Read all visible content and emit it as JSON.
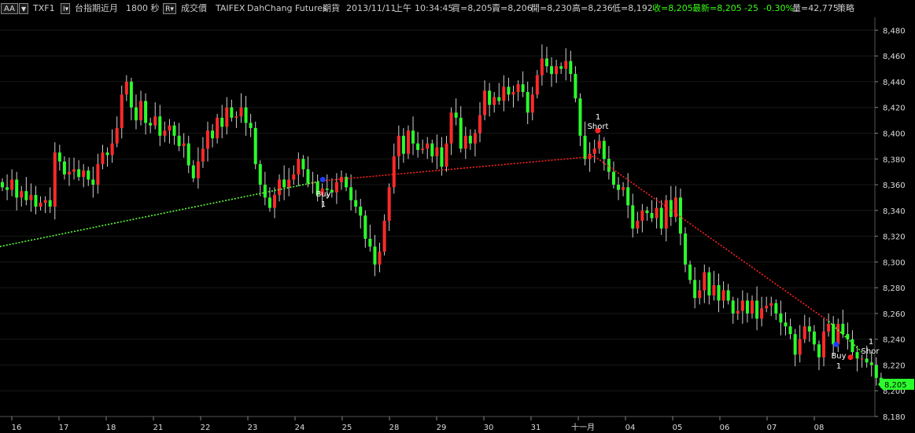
{
  "header": {
    "display_mode": "AA",
    "symbol": "TXF1",
    "contract_name": "台指期近月",
    "interval": "1800 秒",
    "price_type": "成交價",
    "exchange": "TAIFEX",
    "broker": "DahChang Futures",
    "category": "期貨",
    "date": "2013/11/11",
    "ampm": "上午",
    "time": "10:34:45",
    "bid": "買=8,205",
    "ask": "賣=8,206",
    "open": "開=8,230",
    "high": "高=8,236",
    "low": "低=8,192",
    "close": "收=8,205",
    "last": "最新=8,205",
    "change": "-25",
    "change_pct": "-0.30%",
    "volume": "量=42,775",
    "strategy": "策略"
  },
  "colors": {
    "up": "#ff2a2a",
    "down": "#2bff2b",
    "long_line": "#5cff3a",
    "short_line": "#ff2020",
    "buy_marker": "#1a3cff",
    "short_marker": "#ff2020",
    "last_price_bg": "#2bff2b"
  },
  "chart_data": {
    "type": "candlestick",
    "ylim": [
      8180,
      8490
    ],
    "y_ticks": [
      "8,180",
      "8,200",
      "8,220",
      "8,240",
      "8,260",
      "8,280",
      "8,300",
      "8,320",
      "8,340",
      "8,360",
      "8,380",
      "8,400",
      "8,420",
      "8,440",
      "8,460",
      "8,480"
    ],
    "x_ticks": [
      {
        "label": "16",
        "pos": 2
      },
      {
        "label": "17",
        "pos": 12
      },
      {
        "label": "18",
        "pos": 22
      },
      {
        "label": "21",
        "pos": 32
      },
      {
        "label": "22",
        "pos": 42
      },
      {
        "label": "23",
        "pos": 52
      },
      {
        "label": "24",
        "pos": 62
      },
      {
        "label": "25",
        "pos": 72
      },
      {
        "label": "28",
        "pos": 82
      },
      {
        "label": "29",
        "pos": 92
      },
      {
        "label": "30",
        "pos": 102
      },
      {
        "label": "31",
        "pos": 112
      },
      {
        "label": "十一月",
        "pos": 122
      },
      {
        "label": "04",
        "pos": 132
      },
      {
        "label": "05",
        "pos": 142
      },
      {
        "label": "06",
        "pos": 152
      },
      {
        "label": "07",
        "pos": 162
      },
      {
        "label": "08",
        "pos": 172
      }
    ],
    "last_price": "8,205",
    "last_value": 8205,
    "closes": [
      8358,
      8356,
      8364,
      8350,
      8355,
      8348,
      8352,
      8343,
      8346,
      8348,
      8343,
      8385,
      8378,
      8368,
      8370,
      8372,
      8366,
      8371,
      8364,
      8360,
      8376,
      8385,
      8383,
      8392,
      8404,
      8430,
      8440,
      8420,
      8410,
      8425,
      8408,
      8406,
      8413,
      8398,
      8402,
      8406,
      8398,
      8390,
      8392,
      8375,
      8365,
      8378,
      8388,
      8402,
      8396,
      8412,
      8405,
      8420,
      8412,
      8413,
      8420,
      8408,
      8404,
      8376,
      8360,
      8350,
      8342,
      8352,
      8364,
      8358,
      8364,
      8368,
      8380,
      8372,
      8361,
      8362,
      8352,
      8357,
      8356,
      8354,
      8362,
      8366,
      8358,
      8348,
      8343,
      8336,
      8318,
      8312,
      8298,
      8308,
      8332,
      8358,
      8382,
      8398,
      8384,
      8402,
      8392,
      8387,
      8388,
      8392,
      8382,
      8389,
      8374,
      8392,
      8416,
      8412,
      8388,
      8398,
      8392,
      8400,
      8414,
      8433,
      8422,
      8428,
      8425,
      8436,
      8430,
      8432,
      8438,
      8432,
      8416,
      8430,
      8445,
      8458,
      8452,
      8446,
      8452,
      8450,
      8456,
      8446,
      8427,
      8398,
      8380,
      8384,
      8388,
      8394,
      8380,
      8370,
      8360,
      8356,
      8358,
      8344,
      8326,
      8332,
      8340,
      8338,
      8334,
      8342,
      8326,
      8348,
      8335,
      8350,
      8322,
      8298,
      8286,
      8272,
      8278,
      8292,
      8274,
      8282,
      8270,
      8278,
      8270,
      8260,
      8262,
      8270,
      8260,
      8270,
      8256,
      8264,
      8266,
      8268,
      8260,
      8253,
      8250,
      8244,
      8228,
      8240,
      8250,
      8246,
      8236,
      8226,
      8246,
      8252,
      8236,
      8252,
      8244,
      8240,
      8230,
      8225,
      8225,
      8222,
      8220,
      8210,
      8205
    ]
  }
}
